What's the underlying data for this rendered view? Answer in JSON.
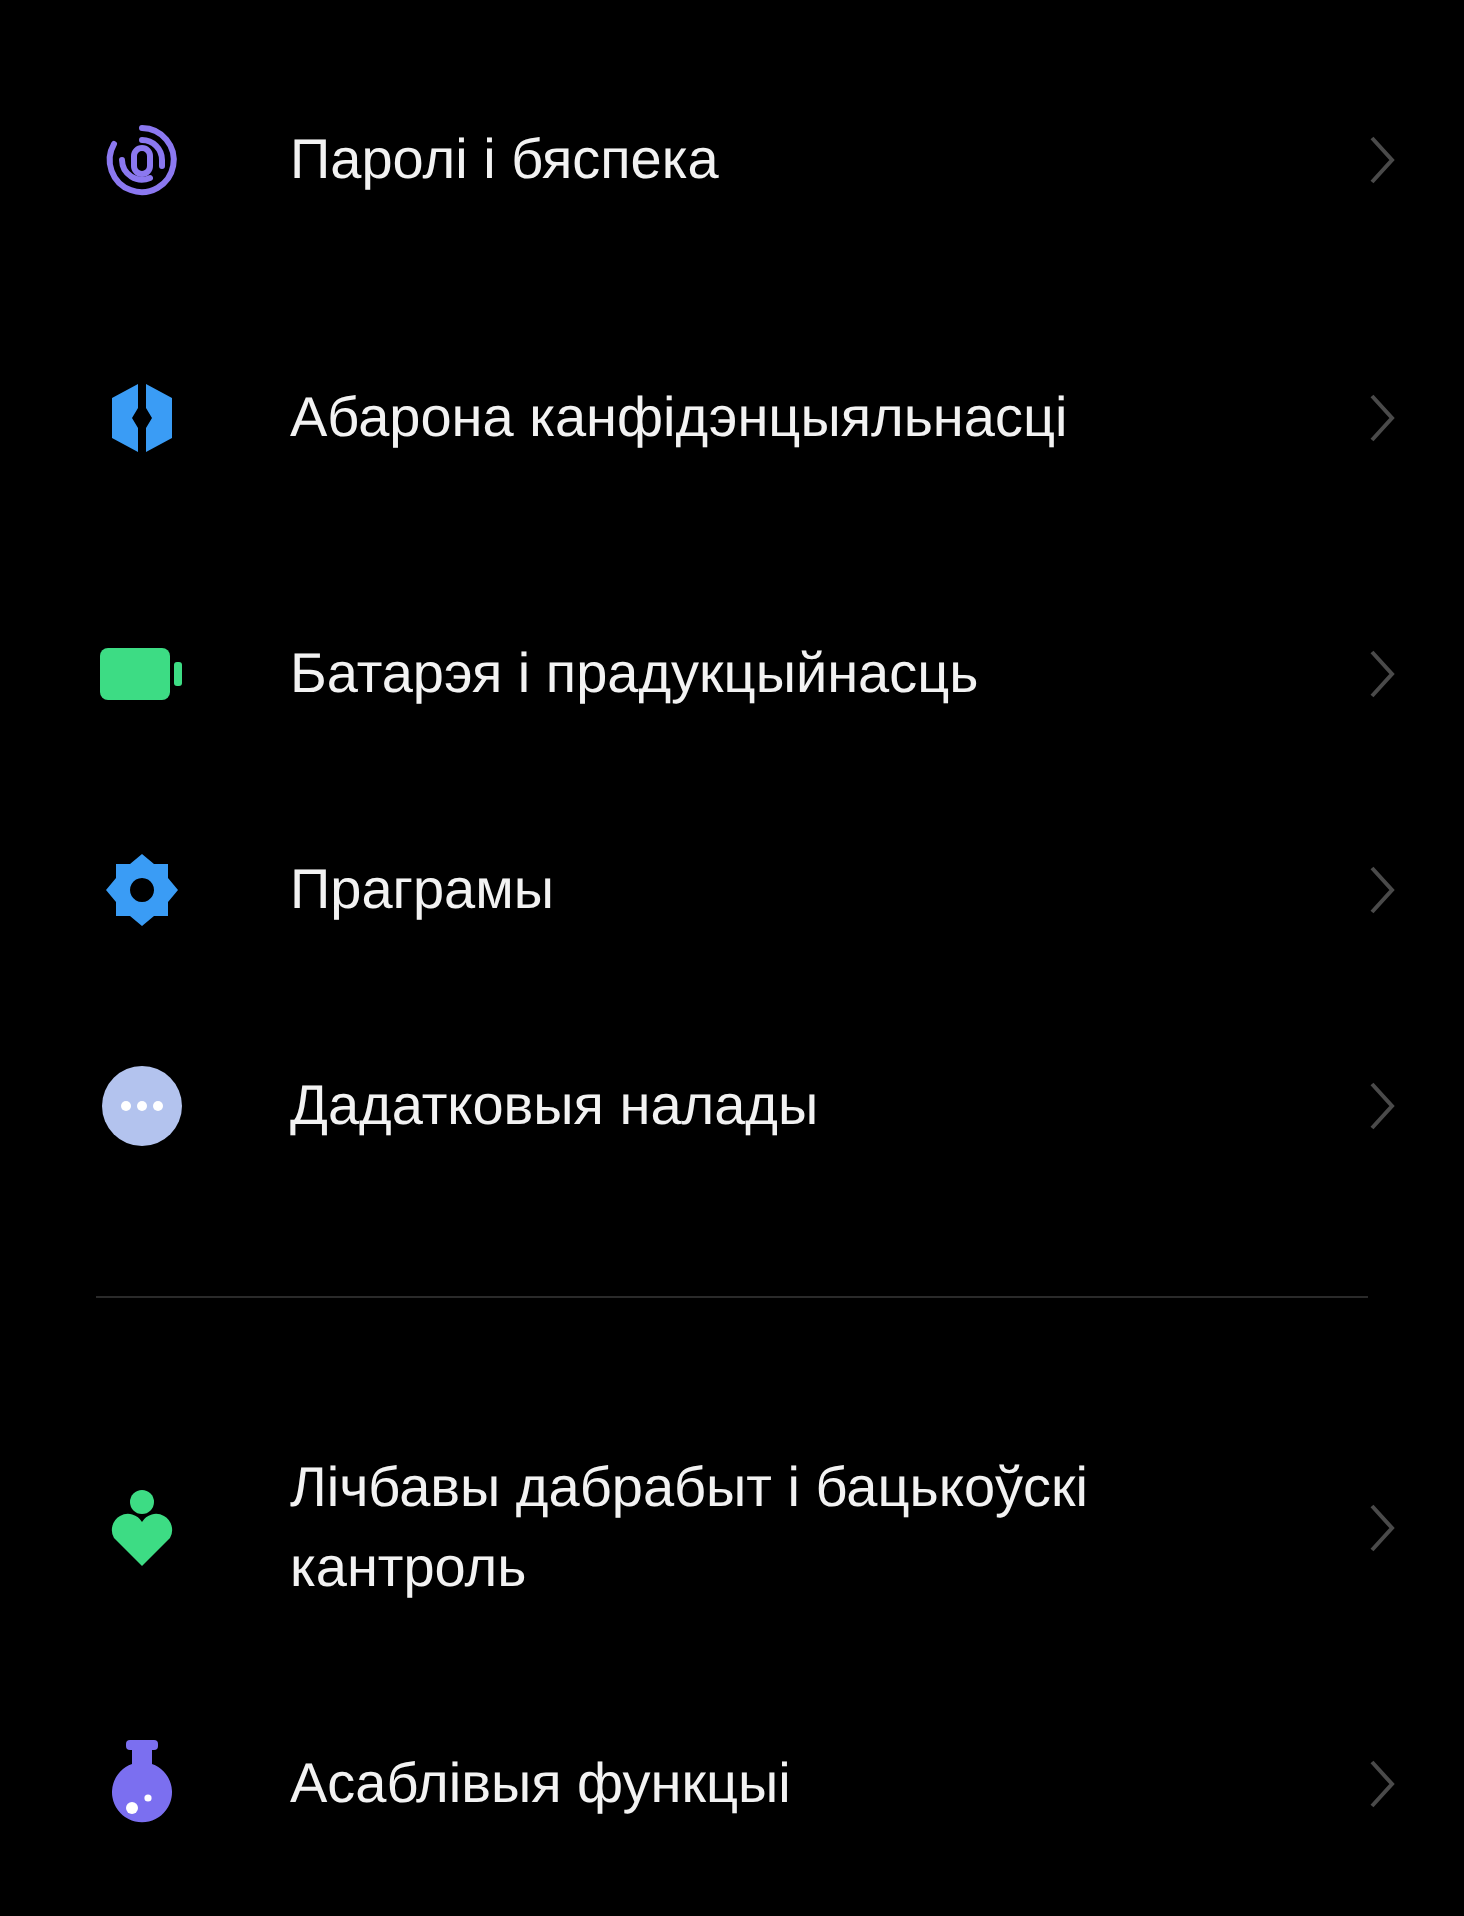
{
  "groups": [
    {
      "items": [
        {
          "kind": "fingerprint",
          "label": "Паролі і бяспека"
        },
        {
          "kind": "shield",
          "label": "Абарона канфідэнцыяльнасці"
        },
        {
          "kind": "battery",
          "label": "Батарэя і прадукцыйнасць"
        },
        {
          "kind": "gear",
          "label": "Праграмы"
        },
        {
          "kind": "more",
          "label": "Дадатковыя налады"
        }
      ]
    },
    {
      "items": [
        {
          "kind": "wellbeing",
          "label": "Лічбавы дабрабыт і бацькоўскі кантроль"
        },
        {
          "kind": "flask",
          "label": "Асаблівыя функцыі"
        }
      ]
    }
  ]
}
